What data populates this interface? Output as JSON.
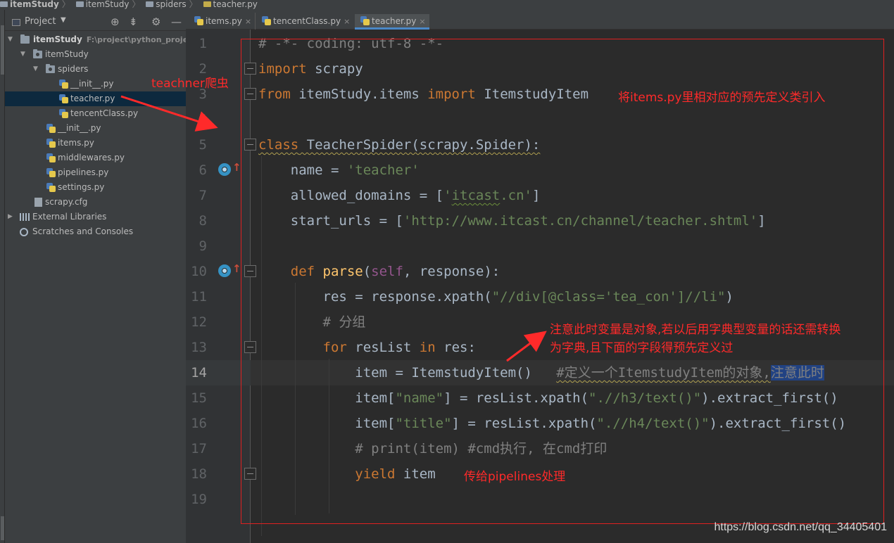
{
  "breadcrumb": [
    "itemStudy",
    "itemStudy",
    "spiders",
    "teacher.py"
  ],
  "project_panel": {
    "title": "Project",
    "tree": [
      {
        "label": "itemStudy",
        "path": "F:\\project\\python_project\\",
        "kind": "folder",
        "expanded": true
      },
      {
        "label": "itemStudy",
        "kind": "package",
        "expanded": true
      },
      {
        "label": "spiders",
        "kind": "package",
        "expanded": true
      },
      {
        "label": "__init__.py",
        "kind": "py"
      },
      {
        "label": "teacher.py",
        "kind": "py",
        "selected": true
      },
      {
        "label": "tencentClass.py",
        "kind": "py"
      },
      {
        "label": "__init__.py",
        "kind": "py"
      },
      {
        "label": "items.py",
        "kind": "py"
      },
      {
        "label": "middlewares.py",
        "kind": "py"
      },
      {
        "label": "pipelines.py",
        "kind": "py"
      },
      {
        "label": "settings.py",
        "kind": "py"
      },
      {
        "label": "scrapy.cfg",
        "kind": "cfg"
      },
      {
        "label": "External Libraries",
        "kind": "lib"
      },
      {
        "label": "Scratches and Consoles",
        "kind": "scratch"
      }
    ]
  },
  "tabs": [
    {
      "label": "items.py",
      "active": false
    },
    {
      "label": "tencentClass.py",
      "active": false
    },
    {
      "label": "teacher.py",
      "active": true
    }
  ],
  "tab_close_glyph": "×",
  "editor": {
    "current_line": 14,
    "line_numbers": [
      "1",
      "2",
      "3",
      "4",
      "5",
      "6",
      "7",
      "8",
      "9",
      "10",
      "11",
      "12",
      "13",
      "14",
      "15",
      "16",
      "17",
      "18",
      "19"
    ],
    "code": {
      "l1": "# -*- coding: utf-8 -*-",
      "l2_kw": "import",
      "l2_rest": " scrapy",
      "l3_kw1": "from",
      "l3_mod": " itemStudy.items ",
      "l3_kw2": "import",
      "l3_rest": " ItemstudyItem",
      "l5_kw": "class",
      "l5_rest": " TeacherSpider(scrapy.Spider):",
      "l6_a": "    name = ",
      "l6_str": "'teacher'",
      "l7_a": "    allowed_domains = [",
      "l7_q1": "'",
      "l7_sq": "itcast",
      "l7_q2": ".cn'",
      "l7_b": "]",
      "l8_a": "    start_urls = [",
      "l8_str": "'http://www.itcast.cn/channel/teacher.shtml'",
      "l8_b": "]",
      "l10_kw": "    def ",
      "l10_fn": "parse",
      "l10_p1": "(",
      "l10_self": "self",
      "l10_p2": ", response):",
      "l11_a": "        res = response.xpath(",
      "l11_str": "\"//div[@class='tea_con']//li\"",
      "l11_b": ")",
      "l12": "        # 分组",
      "l13_kw1": "        for",
      "l13_mid": " resList ",
      "l13_kw2": "in",
      "l13_rest": " res:",
      "l14_a": "            item = ItemstudyItem()   ",
      "l14_cmt": "#定义一个ItemstudyItem的对象,",
      "l14_sel": "注意此时",
      "l15_a": "            item[",
      "l15_str": "\"name\"",
      "l15_b": "] = resList.xpath(",
      "l15_str2": "\".//h3/text()\"",
      "l15_c": ").extract_first()",
      "l16_a": "            item[",
      "l16_str": "\"title\"",
      "l16_b": "] = resList.xpath(",
      "l16_str2": "\".//h4/text()\"",
      "l16_c": ").extract_first()",
      "l17": "            # print(item) #cmd执行, 在cmd打印",
      "l18_kw": "            yield",
      "l18_rest": " item"
    }
  },
  "annotations": {
    "spider_note": "teachner爬虫",
    "import_note": "将items.py里相对应的预先定义类引入",
    "object_note_1": "注意此时变量是对象,若以后用字典型变量的话还需转换",
    "object_note_2": "为字典,且下面的字段得预先定义过",
    "yield_note": "传给pipelines处理",
    "color": "#ff2a2a"
  },
  "watermark": "https://blog.csdn.net/qq_34405401",
  "colors": {
    "keyword": "#cc7832",
    "string": "#6a8759",
    "comment": "#808080",
    "function": "#ffc66d",
    "self": "#94558d",
    "default": "#a9b7c6",
    "background": "#2b2b2b",
    "selection": "#214283"
  }
}
